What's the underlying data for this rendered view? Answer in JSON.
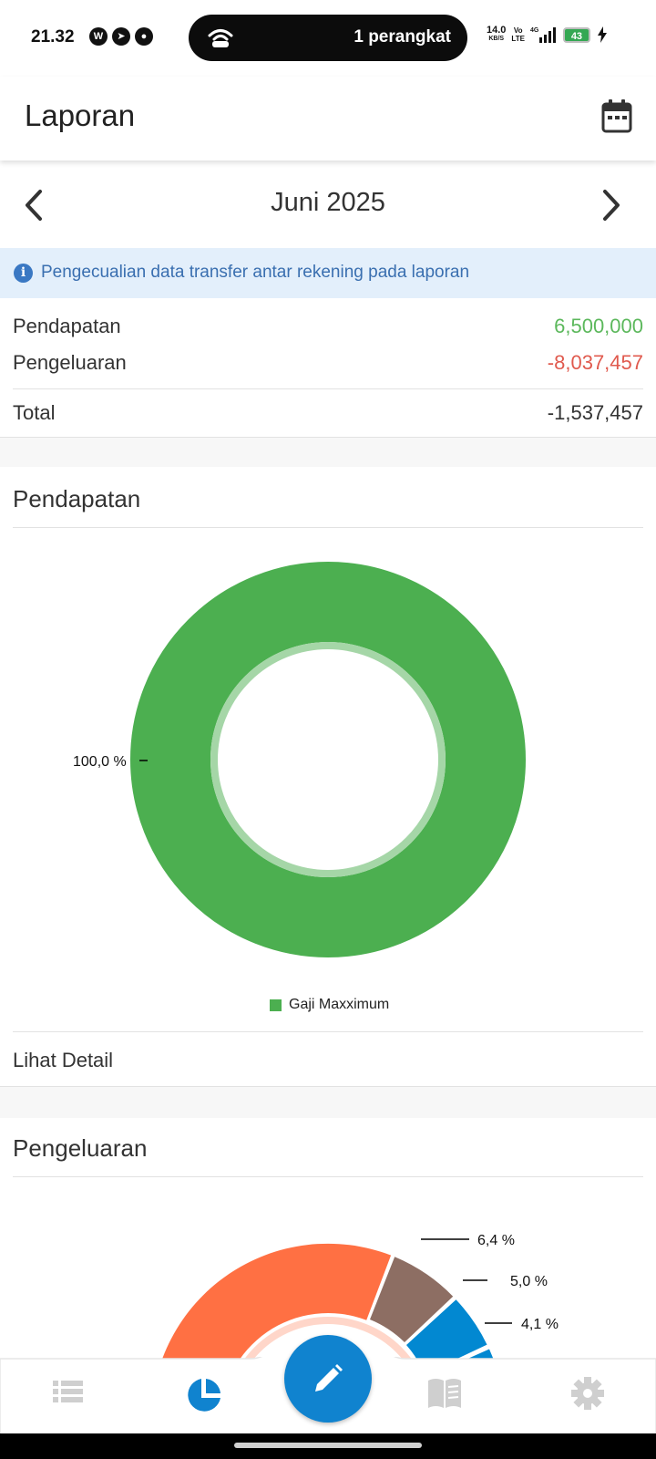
{
  "status_bar": {
    "time": "21.32",
    "apps": [
      {
        "icon": "whatsapp-icon",
        "glyph": "W"
      },
      {
        "icon": "telegram-icon",
        "glyph": "➤"
      },
      {
        "icon": "chat-bubble-icon",
        "glyph": "●"
      }
    ],
    "hotspot_text": "1 perangkat",
    "speed_value": "14.0",
    "speed_unit": "KB/S",
    "volte_top": "Vo",
    "volte_bottom": "LTE",
    "network": "4G",
    "battery": "43"
  },
  "app_bar": {
    "title": "Laporan",
    "calendar_icon": "calendar-icon"
  },
  "month_nav": {
    "label": "Juni 2025",
    "prev_icon": "chevron-left-icon",
    "next_icon": "chevron-right-icon"
  },
  "info_banner": {
    "text": "Pengecualian data transfer antar rekening pada laporan",
    "icon": "info-icon"
  },
  "summary": {
    "income_label": "Pendapatan",
    "income_value": "6,500,000",
    "expense_label": "Pengeluaran",
    "expense_value": "-8,037,457",
    "total_label": "Total",
    "total_value": "-1,537,457",
    "income_color": "#5cb85c",
    "expense_color": "#e05a4e"
  },
  "income_section": {
    "title": "Pendapatan",
    "detail_link": "Lihat Detail"
  },
  "expense_section": {
    "title": "Pengeluaran"
  },
  "chart_data": [
    {
      "type": "pie",
      "title": "Pendapatan",
      "categories": [
        "Gaji Maxximum"
      ],
      "values": [
        100.0
      ],
      "value_labels": [
        "100,0 %"
      ],
      "colors": [
        "#4caf50"
      ],
      "legend": "bottom",
      "donut": true
    },
    {
      "type": "pie",
      "title": "Pengeluaran",
      "partially_visible": true,
      "visible_value_labels": [
        "6,4 %",
        "5,0 %",
        "4,1 %"
      ],
      "visible_values": [
        6.4,
        5.0,
        4.1
      ],
      "colors": [
        "#ff7043",
        "#8d6e63",
        "#0288d1",
        "#0288d1"
      ],
      "donut": true
    }
  ],
  "bottom_nav": {
    "items": [
      {
        "icon": "list-icon"
      },
      {
        "icon": "pie-chart-icon",
        "active": true
      },
      {
        "icon": "book-icon"
      },
      {
        "icon": "gear-icon"
      }
    ],
    "fab_icon": "pencil-icon",
    "active_color": "#1083cf",
    "inactive_color": "#cfcfcf"
  }
}
